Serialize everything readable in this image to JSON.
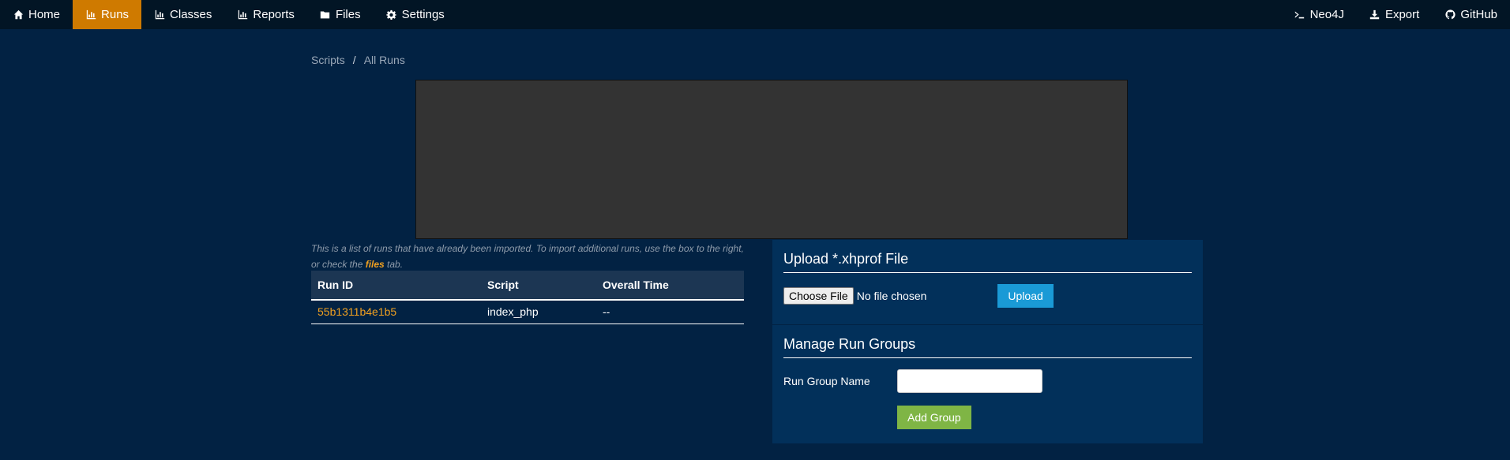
{
  "nav": {
    "left": [
      {
        "label": "Home",
        "icon": "home-icon",
        "active": false
      },
      {
        "label": "Runs",
        "icon": "bar-chart-icon",
        "active": true
      },
      {
        "label": "Classes",
        "icon": "bar-chart-icon",
        "active": false
      },
      {
        "label": "Reports",
        "icon": "bar-chart-icon",
        "active": false
      },
      {
        "label": "Files",
        "icon": "folder-icon",
        "active": false
      },
      {
        "label": "Settings",
        "icon": "gear-icon",
        "active": false
      }
    ],
    "right": [
      {
        "label": "Neo4J",
        "icon": "terminal-icon"
      },
      {
        "label": "Export",
        "icon": "download-icon"
      },
      {
        "label": "GitHub",
        "icon": "github-icon"
      }
    ],
    "active_color": "#cf7a00"
  },
  "breadcrumb": {
    "root": "Scripts",
    "separator": "/",
    "current": "All Runs"
  },
  "intro": {
    "before": "This is a list of runs that have already been imported. To import additional runs, use the box to the right, or check the ",
    "link": "files",
    "after": " tab."
  },
  "runs": {
    "headers": [
      "Run ID",
      "Script",
      "Overall Time"
    ],
    "rows": [
      {
        "run_id": "55b1311b4e1b5",
        "script": "index_php",
        "overall_time": "--"
      }
    ]
  },
  "upload": {
    "title": "Upload *.xhprof File",
    "choose_label": "Choose File",
    "no_file_text": "No file chosen",
    "upload_label": "Upload"
  },
  "groups": {
    "title": "Manage Run Groups",
    "field_label": "Run Group Name",
    "field_value": "",
    "add_label": "Add Group"
  },
  "colors": {
    "background": "#022243",
    "accent": "#cf7a00",
    "link": "#f0a020",
    "upload_button": "#1a9ad6",
    "add_button": "#7fb545"
  }
}
